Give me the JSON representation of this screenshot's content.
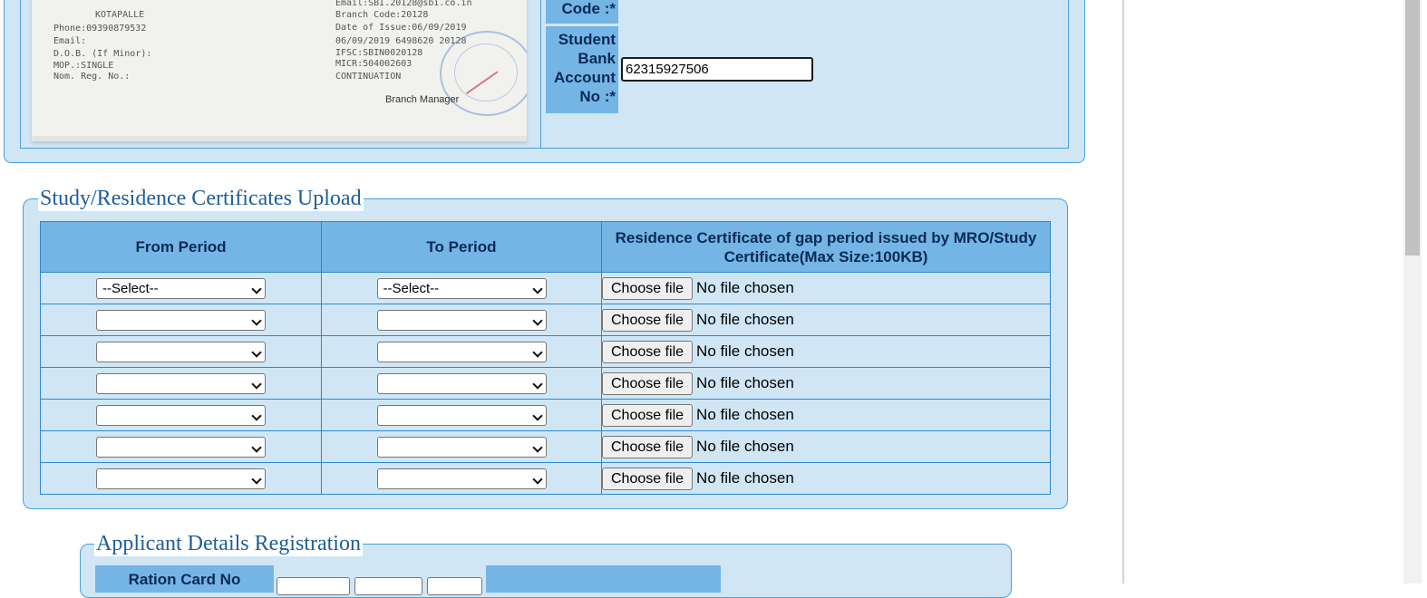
{
  "bank": {
    "code_label": "Code :*",
    "account_label": "Student Bank Account No :*",
    "account_value": "62315927506",
    "passbook": {
      "lines_left": [
        "KOTAPALLE",
        "Phone:09390879532",
        "Email:",
        "D.O.B. (If Minor):",
        "MOP.:SINGLE",
        "Nom. Reg. No.:"
      ],
      "lines_right": [
        "Email:SBI.20128@sbi.co.in",
        "Branch Code:20128",
        "Date of Issue:06/09/2019",
        "06/09/2019  6498620  20128",
        "IFSC:SBIN0020128",
        "MICR:504002603",
        "CONTINUATION"
      ],
      "branch_manager": "Branch Manager"
    }
  },
  "study": {
    "legend": "Study/Residence Certificates Upload",
    "headers": {
      "from": "From Period",
      "to": "To Period",
      "file": "Residence Certificate of gap period issued by MRO/Study Certificate(Max Size:100KB)"
    },
    "rows": [
      {
        "from": "--Select--",
        "to": "--Select--",
        "button": "Choose file",
        "status": "No file chosen"
      },
      {
        "from": "",
        "to": "",
        "button": "Choose file",
        "status": "No file chosen"
      },
      {
        "from": "",
        "to": "",
        "button": "Choose file",
        "status": "No file chosen"
      },
      {
        "from": "",
        "to": "",
        "button": "Choose file",
        "status": "No file chosen"
      },
      {
        "from": "",
        "to": "",
        "button": "Choose file",
        "status": "No file chosen"
      },
      {
        "from": "",
        "to": "",
        "button": "Choose file",
        "status": "No file chosen"
      },
      {
        "from": "",
        "to": "",
        "button": "Choose file",
        "status": "No file chosen"
      }
    ]
  },
  "applicant": {
    "legend": "Applicant Details Registration",
    "ration_label": "Ration Card No"
  },
  "colors": {
    "panel_bg": "#d0e6f5",
    "header_bg": "#74b5e6",
    "border": "#4a9fd8",
    "legend_text": "#1d5e9a"
  }
}
